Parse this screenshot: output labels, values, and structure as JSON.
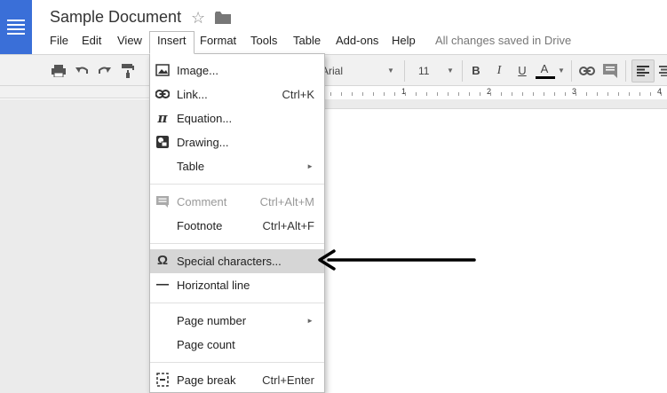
{
  "document": {
    "title": "Sample Document"
  },
  "menubar": {
    "items": [
      "File",
      "Edit",
      "View",
      "Insert",
      "Format",
      "Tools",
      "Table",
      "Add-ons",
      "Help"
    ],
    "active": "Insert",
    "save_status": "All changes saved in Drive"
  },
  "toolbar": {
    "font": "Arial",
    "font_size": "11",
    "bold": "B",
    "italic": "I",
    "underline": "U",
    "text_color": "A"
  },
  "ruler": {
    "numbers": [
      "1",
      "2",
      "3",
      "4"
    ]
  },
  "insert_menu": {
    "items": [
      {
        "icon": "image-icon",
        "label": "Image...",
        "shortcut": "",
        "submenu": false,
        "disabled": false
      },
      {
        "icon": "link-icon",
        "label": "Link...",
        "shortcut": "Ctrl+K",
        "submenu": false,
        "disabled": false
      },
      {
        "icon": "pi-icon",
        "label": "Equation...",
        "shortcut": "",
        "submenu": false,
        "disabled": false
      },
      {
        "icon": "drawing-icon",
        "label": "Drawing...",
        "shortcut": "",
        "submenu": false,
        "disabled": false
      },
      {
        "icon": "",
        "label": "Table",
        "shortcut": "",
        "submenu": true,
        "disabled": false
      },
      {
        "icon": "comment-icon",
        "label": "Comment",
        "shortcut": "Ctrl+Alt+M",
        "submenu": false,
        "disabled": true
      },
      {
        "icon": "",
        "label": "Footnote",
        "shortcut": "Ctrl+Alt+F",
        "submenu": false,
        "disabled": false
      },
      {
        "icon": "omega-icon",
        "label": "Special characters...",
        "shortcut": "",
        "submenu": false,
        "disabled": false,
        "highlighted": true
      },
      {
        "icon": "horizontal-line-icon",
        "label": "Horizontal line",
        "shortcut": "",
        "submenu": false,
        "disabled": false
      },
      {
        "icon": "",
        "label": "Page number",
        "shortcut": "",
        "submenu": true,
        "disabled": false
      },
      {
        "icon": "",
        "label": "Page count",
        "shortcut": "",
        "submenu": false,
        "disabled": false
      },
      {
        "icon": "page-break-icon",
        "label": "Page break",
        "shortcut": "Ctrl+Enter",
        "submenu": false,
        "disabled": false
      }
    ]
  },
  "colors": {
    "brand_blue": "#3a6fd8",
    "highlight": "#d6d6d6",
    "text_color_bar": "#000000"
  }
}
